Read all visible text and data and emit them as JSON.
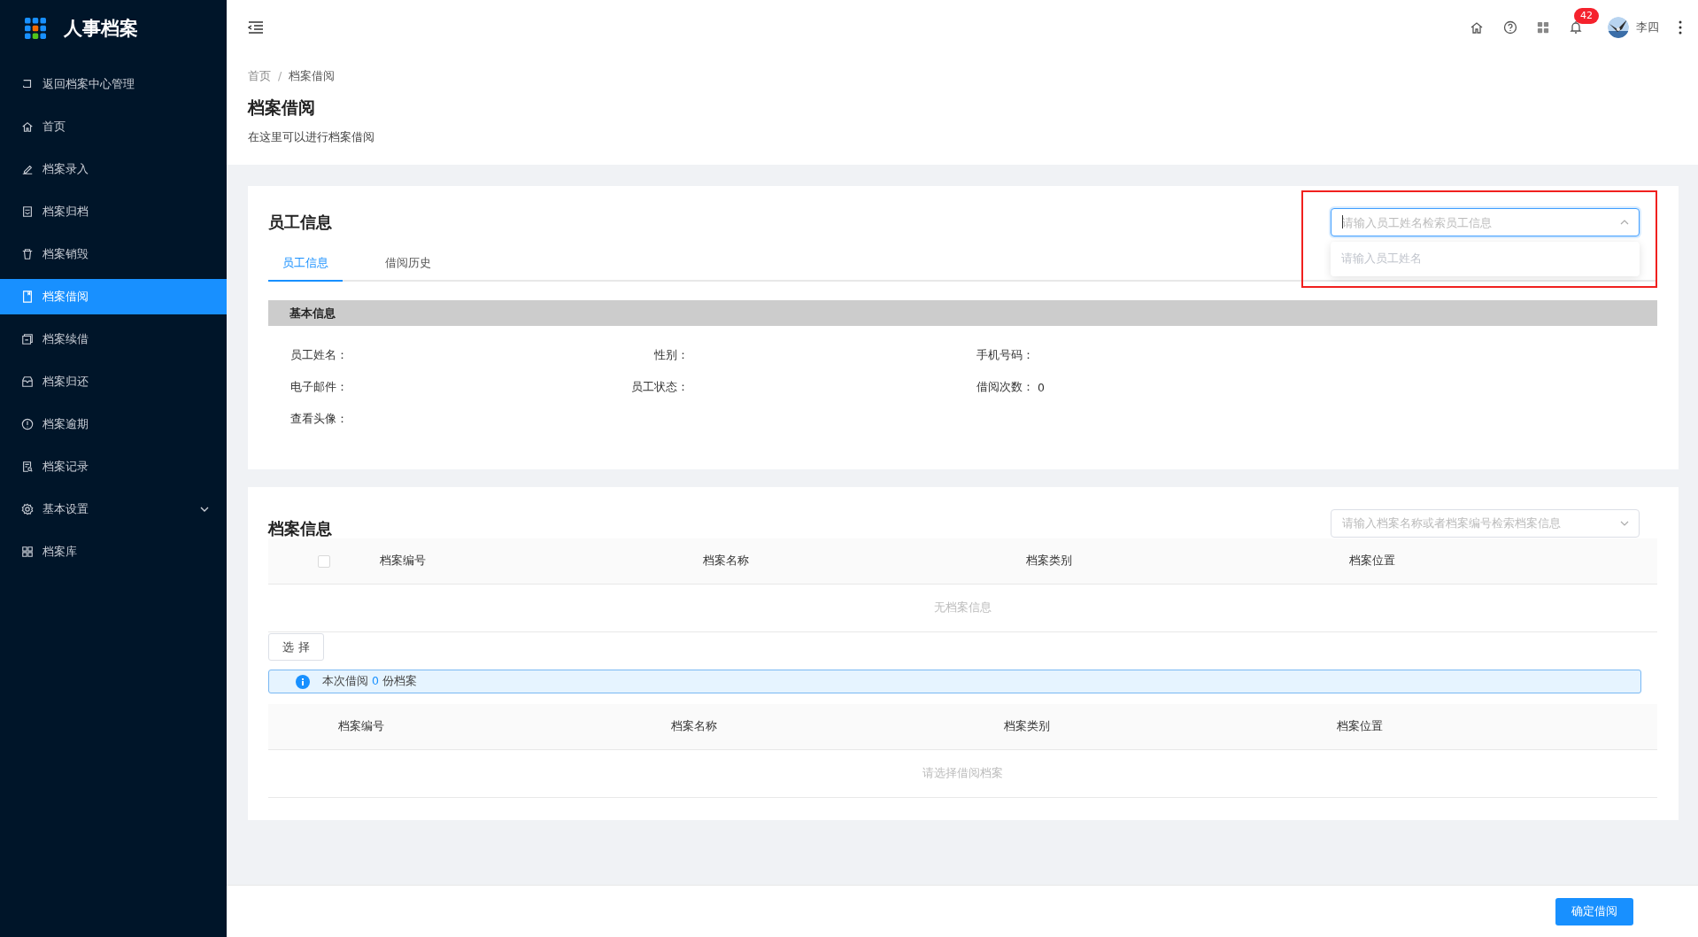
{
  "app": {
    "title": "人事档案"
  },
  "sidebar": {
    "items": [
      {
        "label": "返回档案中心管理",
        "kind": "item",
        "selected": false
      },
      {
        "label": "首页",
        "kind": "item",
        "selected": false
      },
      {
        "label": "档案录入",
        "kind": "item",
        "selected": false
      },
      {
        "label": "档案归档",
        "kind": "item",
        "selected": false
      },
      {
        "label": "档案销毁",
        "kind": "item",
        "selected": false
      },
      {
        "label": "档案借阅",
        "kind": "item",
        "selected": true
      },
      {
        "label": "档案续借",
        "kind": "item",
        "selected": false
      },
      {
        "label": "档案归还",
        "kind": "item",
        "selected": false
      },
      {
        "label": "档案逾期",
        "kind": "item",
        "selected": false
      },
      {
        "label": "档案记录",
        "kind": "item",
        "selected": false
      },
      {
        "label": "基本设置",
        "kind": "submenu",
        "selected": false,
        "expanded": false
      },
      {
        "label": "档案库",
        "kind": "item",
        "selected": false
      }
    ]
  },
  "header": {
    "notification_count": "42",
    "user": "李四"
  },
  "breadcrumb": [
    "首页",
    "档案借阅"
  ],
  "breadcrumb_separator": "/",
  "page": {
    "title": "档案借阅",
    "subtitle": "在这里可以进行档案借阅"
  },
  "employee_card": {
    "title": "员工信息",
    "search": {
      "placeholder": "请输入员工姓名检索员工信息",
      "expanded": true,
      "dropdown_hint": "请输入员工姓名"
    },
    "tabs": [
      {
        "label": "员工信息",
        "selected": true
      },
      {
        "label": "借阅历史",
        "selected": false
      }
    ],
    "section_title": "基本信息",
    "fields": [
      {
        "label": "员工姓名："
      },
      {
        "label": "性别："
      },
      {
        "label": "手机号码："
      },
      {
        "label": "电子邮件："
      },
      {
        "label": "员工状态："
      },
      {
        "label": "借阅次数：",
        "value": "0"
      },
      {
        "label": "查看头像："
      }
    ]
  },
  "archive_card": {
    "title": "档案信息",
    "search": {
      "placeholder": "请输入档案名称或者档案编号检索档案信息",
      "expanded": false
    },
    "table": {
      "columns": [
        "档案编号",
        "档案名称",
        "档案类别",
        "档案位置"
      ],
      "select_all_checked": false,
      "empty_text": "无档案信息"
    },
    "select_button": "选 择",
    "alert": {
      "prefix": "本次借阅",
      "count": "0",
      "suffix": "份档案"
    },
    "selected_table": {
      "columns": [
        "档案编号",
        "档案名称",
        "档案类别",
        "档案位置"
      ],
      "empty_text": "请选择借阅档案"
    }
  },
  "footer": {
    "confirm_button": "确定借阅"
  }
}
